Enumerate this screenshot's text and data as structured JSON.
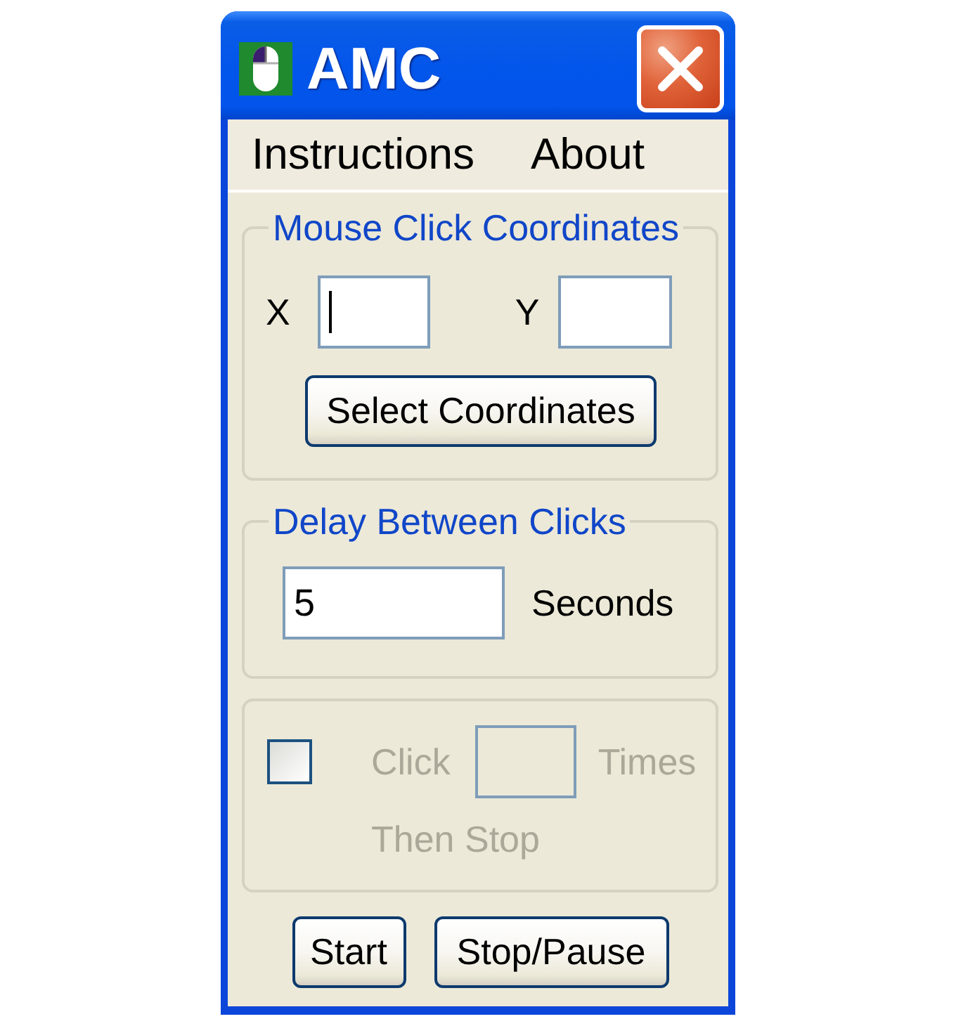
{
  "window": {
    "title": "AMC"
  },
  "menu": [
    {
      "label": "Instructions"
    },
    {
      "label": "About"
    }
  ],
  "coordinates": {
    "title": "Mouse Click Coordinates",
    "fields": [
      {
        "label": "X",
        "focused": true
      },
      {
        "label": "Y",
        "focused": false
      }
    ],
    "button": "Select Coordinates"
  },
  "delay": {
    "title": "Delay Between Clicks",
    "value": "5",
    "unit": "Seconds"
  },
  "repeat": {
    "disabled": true,
    "checked": false,
    "label": "Click",
    "unit": "Times",
    "note": "Then Stop"
  },
  "buttons": [
    "Start",
    "Stop/Pause"
  ]
}
